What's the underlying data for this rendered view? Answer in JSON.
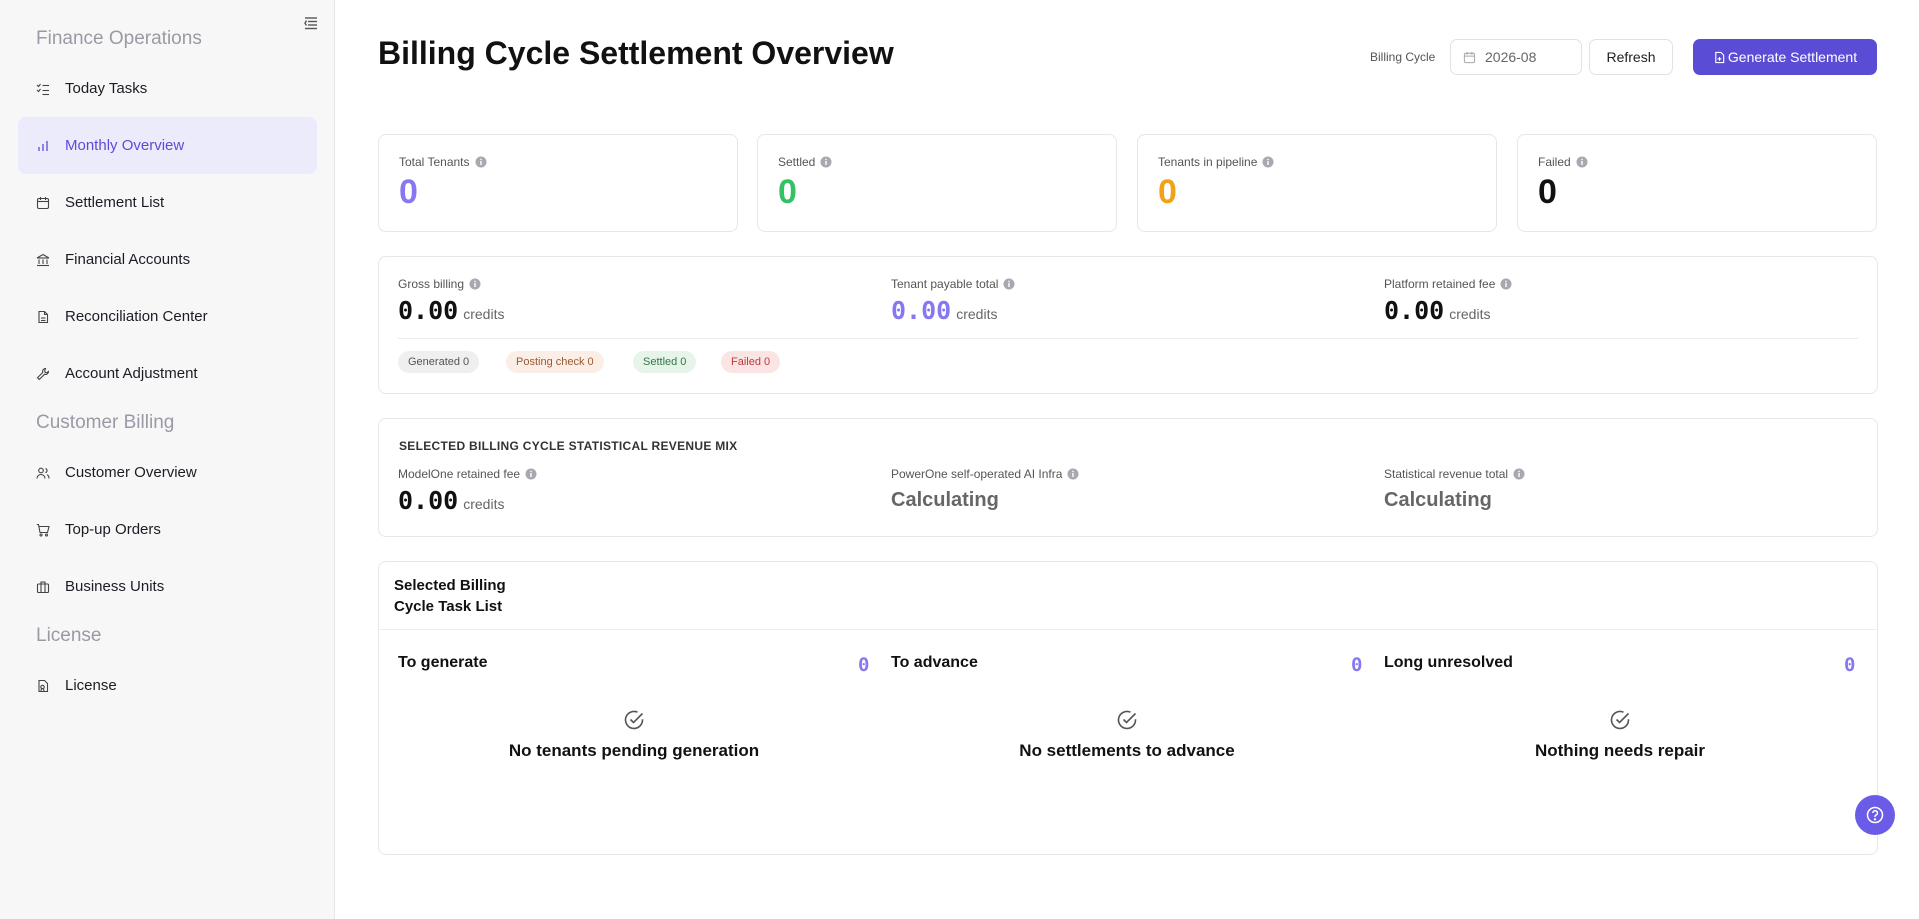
{
  "sidebar": {
    "sections": [
      {
        "title": "Finance Operations"
      },
      {
        "title": "Customer Billing"
      },
      {
        "title": "License"
      }
    ],
    "items": [
      {
        "label": "Today Tasks",
        "icon": "checklist-icon"
      },
      {
        "label": "Monthly Overview",
        "icon": "bar-chart-icon",
        "active": true
      },
      {
        "label": "Settlement List",
        "icon": "calendar-icon"
      },
      {
        "label": "Financial Accounts",
        "icon": "bank-icon"
      },
      {
        "label": "Reconciliation Center",
        "icon": "document-icon"
      },
      {
        "label": "Account Adjustment",
        "icon": "wrench-icon"
      },
      {
        "label": "Customer Overview",
        "icon": "users-icon"
      },
      {
        "label": "Top-up Orders",
        "icon": "cart-icon"
      },
      {
        "label": "Business Units",
        "icon": "building-icon"
      },
      {
        "label": "License",
        "icon": "license-icon"
      }
    ]
  },
  "header": {
    "title": "Billing Cycle Settlement Overview",
    "cycle_label": "Billing Cycle",
    "cycle_value": "2026-08",
    "refresh_label": "Refresh",
    "generate_label": "Generate Settlement"
  },
  "stats": [
    {
      "label": "Total Tenants",
      "value": "0",
      "color": "#8678f0"
    },
    {
      "label": "Settled",
      "value": "0",
      "color": "#34c065"
    },
    {
      "label": "Tenants in pipeline",
      "value": "0",
      "color": "#f0a21b"
    },
    {
      "label": "Failed",
      "value": "0",
      "color": "#111111"
    }
  ],
  "billing": {
    "gross_label": "Gross billing",
    "gross_value": "0.00",
    "payable_label": "Tenant payable total",
    "payable_value": "0.00",
    "platform_label": "Platform retained fee",
    "platform_value": "0.00",
    "unit": "credits",
    "badges": {
      "generated": "Generated 0",
      "posting": "Posting check 0",
      "settled": "Settled 0",
      "failed": "Failed 0"
    }
  },
  "mix": {
    "title": "SELECTED BILLING CYCLE STATISTICAL REVENUE MIX",
    "modelone_label": "ModelOne retained fee",
    "modelone_value": "0.00",
    "unit": "credits",
    "powerone_label": "PowerOne self-operated AI Infra",
    "powerone_value": "Calculating",
    "total_label": "Statistical revenue total",
    "total_value": "Calculating"
  },
  "tasks": {
    "title": "Selected Billing Cycle Task List",
    "columns": [
      {
        "title": "To generate",
        "count": "0",
        "empty": "No tenants pending generation"
      },
      {
        "title": "To advance",
        "count": "0",
        "empty": "No settlements to advance"
      },
      {
        "title": "Long unresolved",
        "count": "0",
        "empty": "Nothing needs repair"
      }
    ]
  },
  "colors": {
    "accent": "#5b4cd6",
    "accent_light": "#8678f0",
    "active_bg": "#ecebfc"
  }
}
